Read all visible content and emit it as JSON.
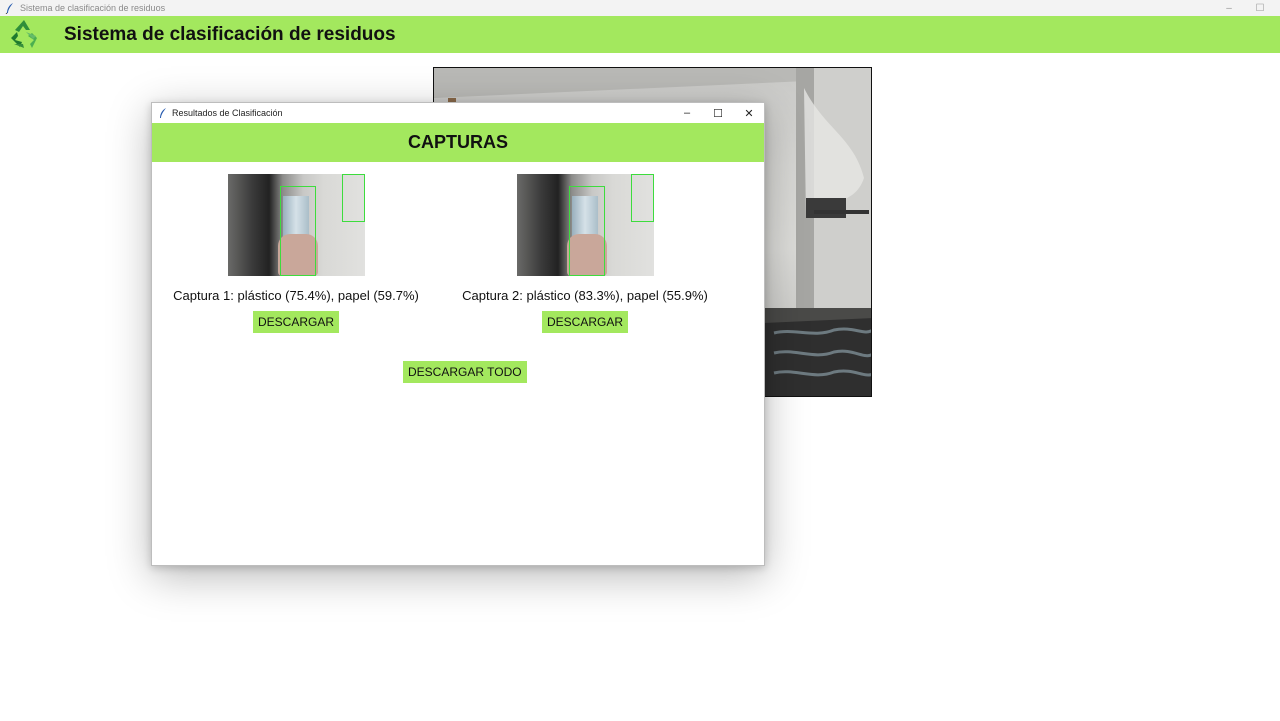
{
  "main_window": {
    "title": "Sistema de clasificación de residuos",
    "controls": {
      "minimize": "–",
      "maximize": "☐"
    }
  },
  "header": {
    "logo_icon": "recycle-icon",
    "title": "Sistema de clasificación de residuos",
    "background": "#a3e85e"
  },
  "dialog": {
    "title": "Resultados de Clasificación",
    "controls": {
      "minimize": "–",
      "maximize": "☐",
      "close": "✕"
    },
    "heading": "CAPTURAS",
    "captures": [
      {
        "label": "Captura 1: plástico (75.4%), papel (59.7%)",
        "button": "DESCARGAR"
      },
      {
        "label": "Captura 2: plástico (83.3%), papel (55.9%)",
        "button": "DESCARGAR"
      }
    ],
    "download_all": "DESCARGAR TODO"
  },
  "colors": {
    "accent": "#a3e85e",
    "detection_box": "#3ddc3d"
  }
}
